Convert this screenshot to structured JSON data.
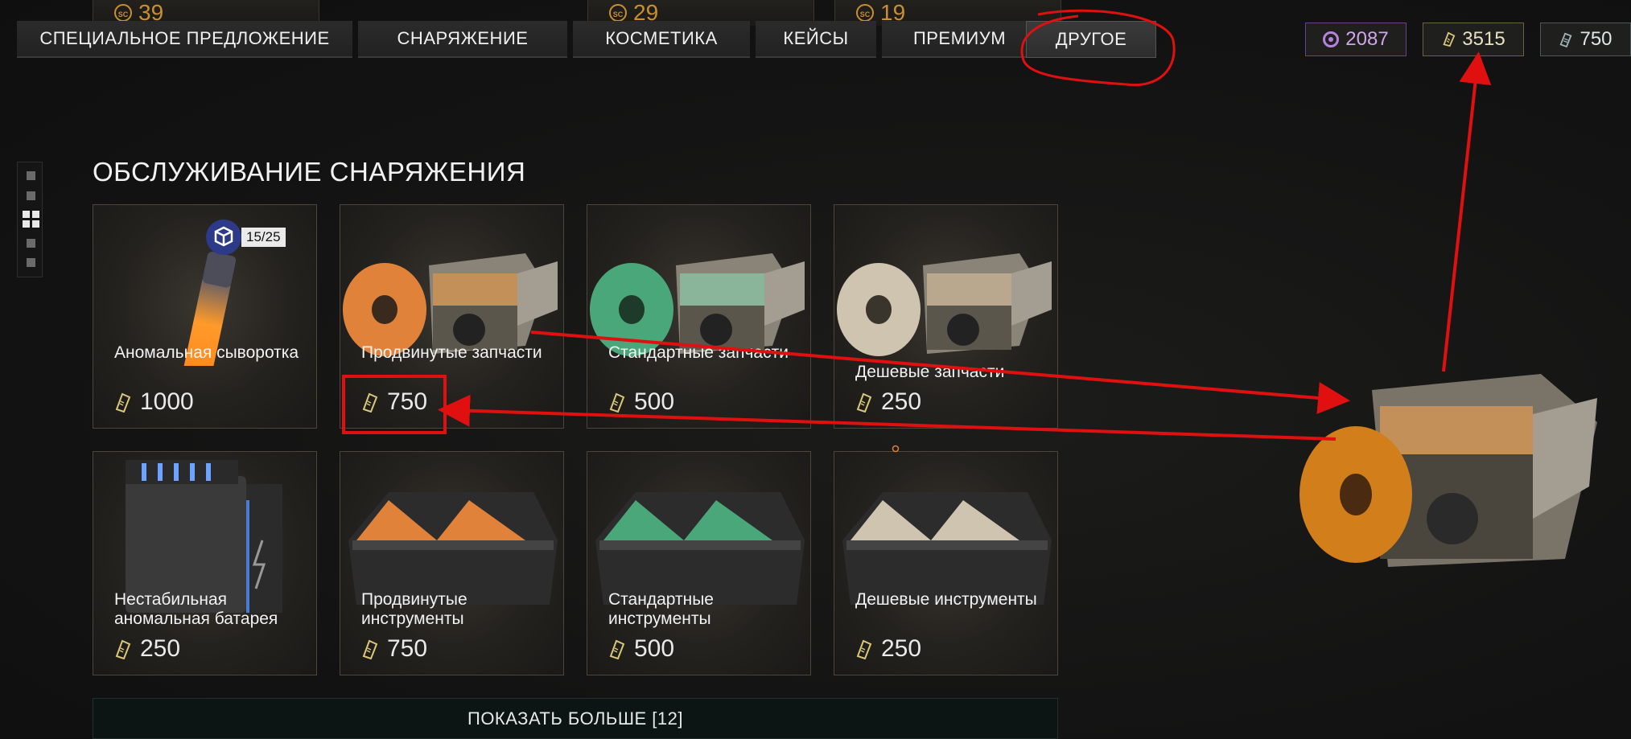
{
  "top_cards": [
    {
      "price": "39"
    },
    {
      "price": "29"
    },
    {
      "price": "19"
    }
  ],
  "tabs": [
    {
      "label": "СПЕЦИАЛЬНОЕ ПРЕДЛОЖЕНИЕ"
    },
    {
      "label": "СНАРЯЖЕНИЕ"
    },
    {
      "label": "КОСМЕТИКА"
    },
    {
      "label": "КЕЙСЫ"
    },
    {
      "label": "ПРЕМИУМ"
    },
    {
      "label": "ДРУГОЕ"
    }
  ],
  "active_tab": "ДРУГОЕ",
  "currencies": [
    {
      "icon": "premium-coin-icon",
      "value": "2087",
      "color": "#b682dd"
    },
    {
      "icon": "token-icon",
      "value": "3515",
      "color": "#d9c77a"
    },
    {
      "icon": "ticket-icon",
      "value": "750",
      "color": "#9fb4b8"
    }
  ],
  "section": {
    "title": "ОБСЛУЖИВАНИЕ СНАРЯЖЕНИЯ"
  },
  "items": [
    {
      "name": "Аномальная сыворотка",
      "price": "1000",
      "badge": "15/25",
      "accent": "#ff8a1c"
    },
    {
      "name": "Продвинутые запчасти",
      "price": "750",
      "accent": "#e0823a"
    },
    {
      "name": "Стандартные запчасти",
      "price": "500",
      "accent": "#4aa77a"
    },
    {
      "name": "Дешевые запчасти",
      "price": "250",
      "accent": "#cfc4b0"
    },
    {
      "name": "Нестабильная аномальная батарея",
      "price": "250",
      "accent": "#4a7bd6"
    },
    {
      "name": "Продвинутые инструменты",
      "price": "750",
      "accent": "#e0823a"
    },
    {
      "name": "Стандартные инструменты",
      "price": "500",
      "accent": "#4aa77a"
    },
    {
      "name": "Дешевые инструменты",
      "price": "250",
      "accent": "#cfc4b0"
    }
  ],
  "show_more": "ПОКАЗАТЬ БОЛЬШЕ [12]",
  "annotation_color": "#e01010"
}
